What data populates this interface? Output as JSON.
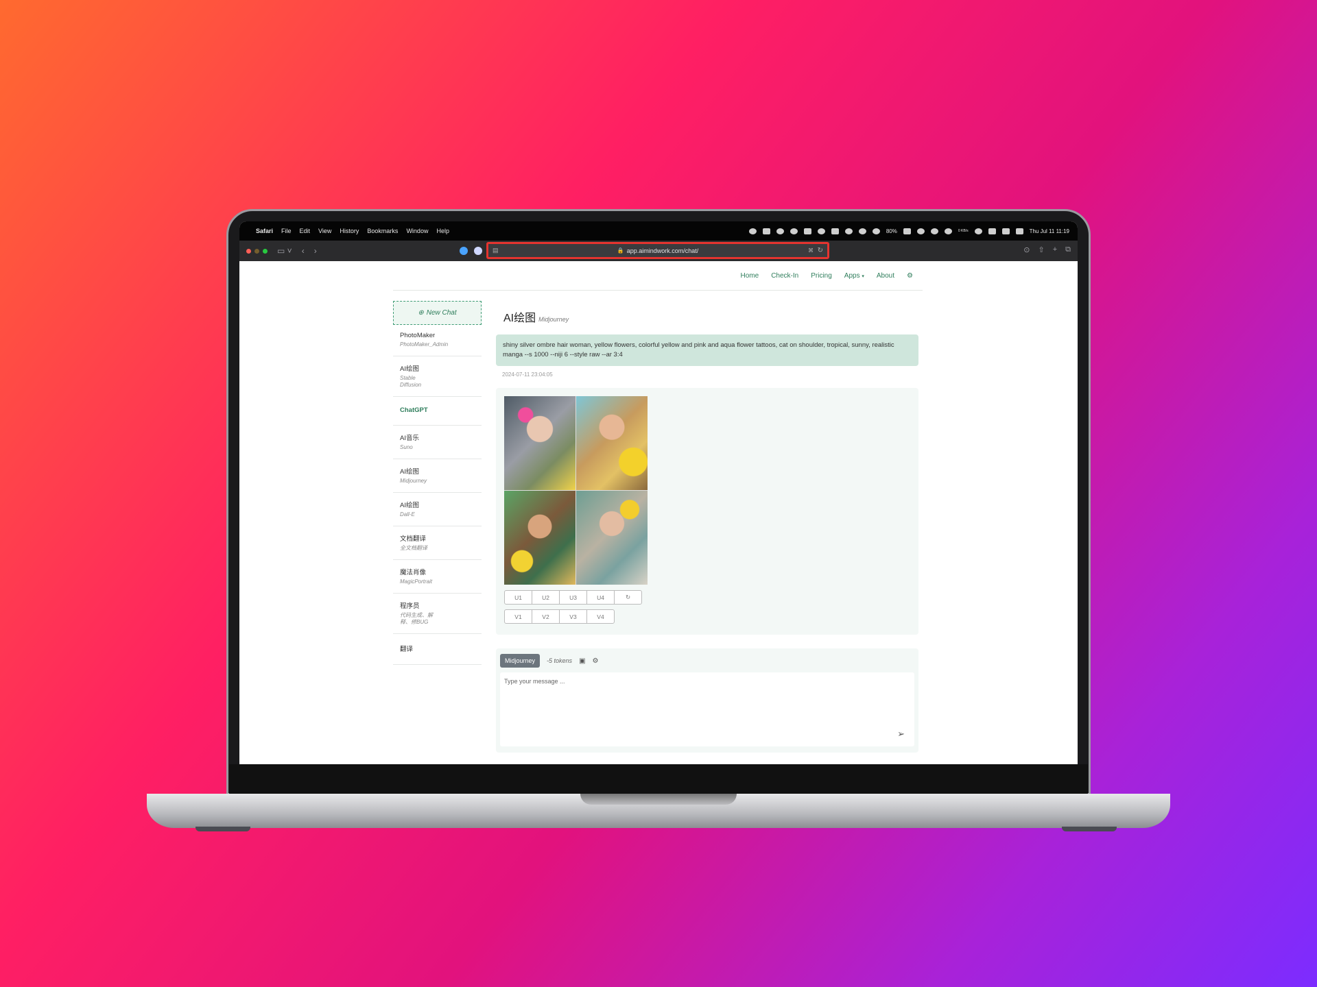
{
  "menubar": {
    "app": "Safari",
    "menus": [
      "File",
      "Edit",
      "View",
      "History",
      "Bookmarks",
      "Window",
      "Help"
    ],
    "battery": "80%",
    "network": "0 KB/s",
    "clock": "Thu Jul 11  11:19"
  },
  "browser": {
    "url": "app.aimindwork.com/chat/"
  },
  "nav": {
    "items": [
      "Home",
      "Check-In",
      "Pricing",
      "Apps",
      "About"
    ]
  },
  "sidebar": {
    "new_chat": "New Chat",
    "items": [
      {
        "title": "PhotoMaker",
        "sub": "PhotoMaker_Admin"
      },
      {
        "title": "AI绘图",
        "sub": "Stable Diffusion"
      },
      {
        "title": "ChatGPT",
        "sub": ""
      },
      {
        "title": "AI音乐",
        "sub": "Suno"
      },
      {
        "title": "AI绘图",
        "sub": "Midjourney"
      },
      {
        "title": "AI绘图",
        "sub": "Dall-E"
      },
      {
        "title": "文档翻译",
        "sub": "全文档翻译"
      },
      {
        "title": "魔法肖像",
        "sub": "MagicPortrait"
      },
      {
        "title": "程序员",
        "sub": "代码生成、解释、修BUG"
      },
      {
        "title": "翻译",
        "sub": ""
      }
    ]
  },
  "chat": {
    "title": "AI绘图",
    "subtitle": "Midjourney",
    "user_message": "shiny silver ombre hair woman, yellow flowers, colorful yellow and pink and aqua flower tattoos, cat on shoulder, tropical, sunny, realistic manga --s 1000 --niji 6 --style raw --ar 3:4",
    "timestamp": "2024-07-11 23:04:05",
    "upscale_buttons": [
      "U1",
      "U2",
      "U3",
      "U4"
    ],
    "variation_buttons": [
      "V1",
      "V2",
      "V3",
      "V4"
    ]
  },
  "composer": {
    "model": "Midjourney",
    "tokens": "-5 tokens",
    "placeholder": "Type your message ..."
  }
}
